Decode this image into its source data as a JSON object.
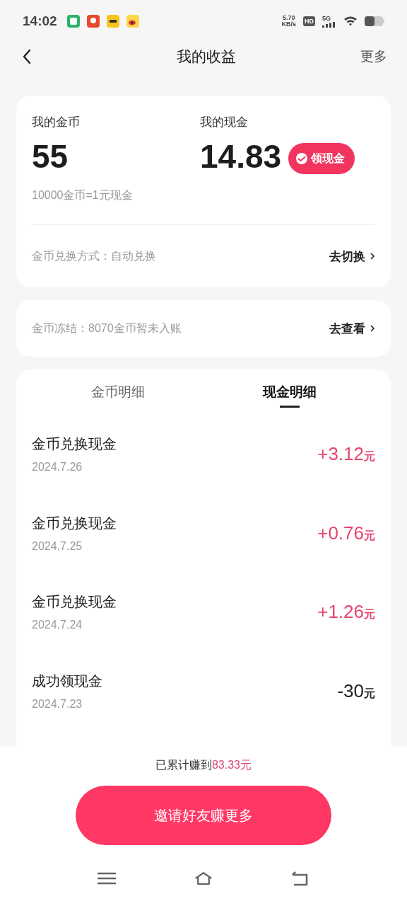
{
  "status_bar": {
    "time": "14:02",
    "speed_value": "5.70",
    "speed_unit": "KB/s",
    "hd_badge": "HD",
    "network": "5G"
  },
  "header": {
    "title": "我的收益",
    "action": "更多"
  },
  "balance_card": {
    "coins_label": "我的金币",
    "coins_value": "55",
    "cash_label": "我的现金",
    "cash_value": "14.83",
    "withdraw_button": "领现金",
    "rate_note": "10000金币=1元现金",
    "exchange_label": "金币兑换方式：自动兑换",
    "exchange_action": "去切换"
  },
  "frozen_card": {
    "text": "金币冻结：8070金币暂未入账",
    "action": "去查看"
  },
  "tabs": [
    {
      "label": "金币明细",
      "selected": false
    },
    {
      "label": "现金明细",
      "selected": true
    }
  ],
  "transactions": [
    {
      "title": "金币兑换现金",
      "date": "2024.7.26",
      "amount": "+3.12",
      "unit": "元",
      "kind": "income"
    },
    {
      "title": "金币兑换现金",
      "date": "2024.7.25",
      "amount": "+0.76",
      "unit": "元",
      "kind": "income"
    },
    {
      "title": "金币兑换现金",
      "date": "2024.7.24",
      "amount": "+1.26",
      "unit": "元",
      "kind": "income"
    },
    {
      "title": "成功领现金",
      "date": "2024.7.23",
      "amount": "-30",
      "unit": "元",
      "kind": "expense"
    }
  ],
  "footer": {
    "summary_label": "已累计赚到",
    "summary_value": "83.33元",
    "invite_button": "邀请好友赚更多"
  }
}
